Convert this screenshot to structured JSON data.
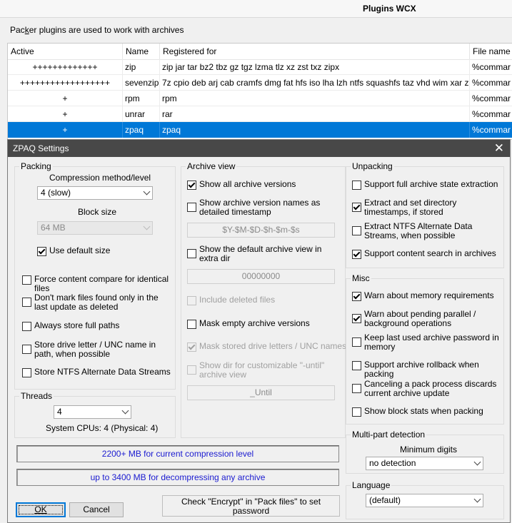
{
  "window": {
    "title": "Plugins WCX"
  },
  "description": {
    "pre": "Pac",
    "underline": "k",
    "post": "er plugins are used to work with archives"
  },
  "plugins": {
    "columns": [
      "Active",
      "Name",
      "Registered for",
      "File name"
    ],
    "rows": [
      {
        "active": "+++++++++++++",
        "name": "zip",
        "registered": "zip jar tar bz2 tbz gz tgz lzma tlz xz zst txz zipx",
        "file": "%commar"
      },
      {
        "active": "++++++++++++++++++",
        "name": "sevenzip",
        "registered": "7z cpio deb arj cab cramfs dmg fat hfs iso lha lzh ntfs squashfs taz vhd wim xar z",
        "file": "%commar"
      },
      {
        "active": "+",
        "name": "rpm",
        "registered": "rpm",
        "file": "%commar"
      },
      {
        "active": "+",
        "name": "unrar",
        "registered": "rar",
        "file": "%commar"
      },
      {
        "active": "+",
        "name": "zpaq",
        "registered": "zpaq",
        "file": "%commar"
      }
    ]
  },
  "dialog": {
    "title": "ZPAQ Settings",
    "close_icon": "close-icon",
    "packing": {
      "legend": "Packing",
      "method_label": "Compression method/level",
      "method_value": "4 (slow)",
      "block_label": "Block size",
      "block_value": "64 MB",
      "use_default": "Use default size",
      "force_compare": "Force content compare for identical files",
      "dont_mark": "Don't mark files found only in the last update as deleted",
      "full_paths": "Always store full paths",
      "drive_letter": "Store drive letter / UNC name in path, when possible",
      "ntfs_streams": "Store NTFS Alternate Data Streams"
    },
    "threads": {
      "legend": "Threads",
      "value": "4",
      "cpus": "System CPUs: 4 (Physical: 4)"
    },
    "archive_view": {
      "legend": "Archive view",
      "all_versions": "Show all archive versions",
      "version_names": "Show archive version names as detailed timestamp",
      "timestamp_format": "$Y-$M-$D-$h-$m-$s",
      "default_view": "Show the default archive view in extra dir",
      "hex_value": "00000000",
      "include_deleted": "Include deleted files",
      "mask_empty": "Mask empty archive versions",
      "mask_drive": "Mask stored drive letters / UNC names",
      "show_dir": "Show dir for customizable \"-until\" archive view",
      "until_value": "_Until"
    },
    "unpacking": {
      "legend": "Unpacking",
      "full_state": "Support full archive state extraction",
      "timestamps": "Extract and set directory timestamps, if stored",
      "ntfs_extract": "Extract NTFS Alternate Data Streams, when possible",
      "content_search": "Support content search in archives"
    },
    "misc": {
      "legend": "Misc",
      "memory_warn": "Warn about memory requirements",
      "pending_warn": "Warn about pending parallel / background operations",
      "keep_password": "Keep last used archive password in memory",
      "rollback": "Support archive rollback when packing",
      "cancel_discard": "Canceling a pack process discards current archive update",
      "block_stats": "Show block stats when packing"
    },
    "multipart": {
      "legend": "Multi-part detection",
      "digits_label": "Minimum digits",
      "digits_value": "no detection"
    },
    "language": {
      "legend": "Language",
      "value": "(default)"
    },
    "info_compress": "2200+ MB for current compression level",
    "info_decompress": "up to 3400 MB for decompressing any archive",
    "encrypt_note": "Check \"Encrypt\" in \"Pack files\" to set password",
    "ok_label": "OK",
    "cancel_label": "Cancel"
  }
}
